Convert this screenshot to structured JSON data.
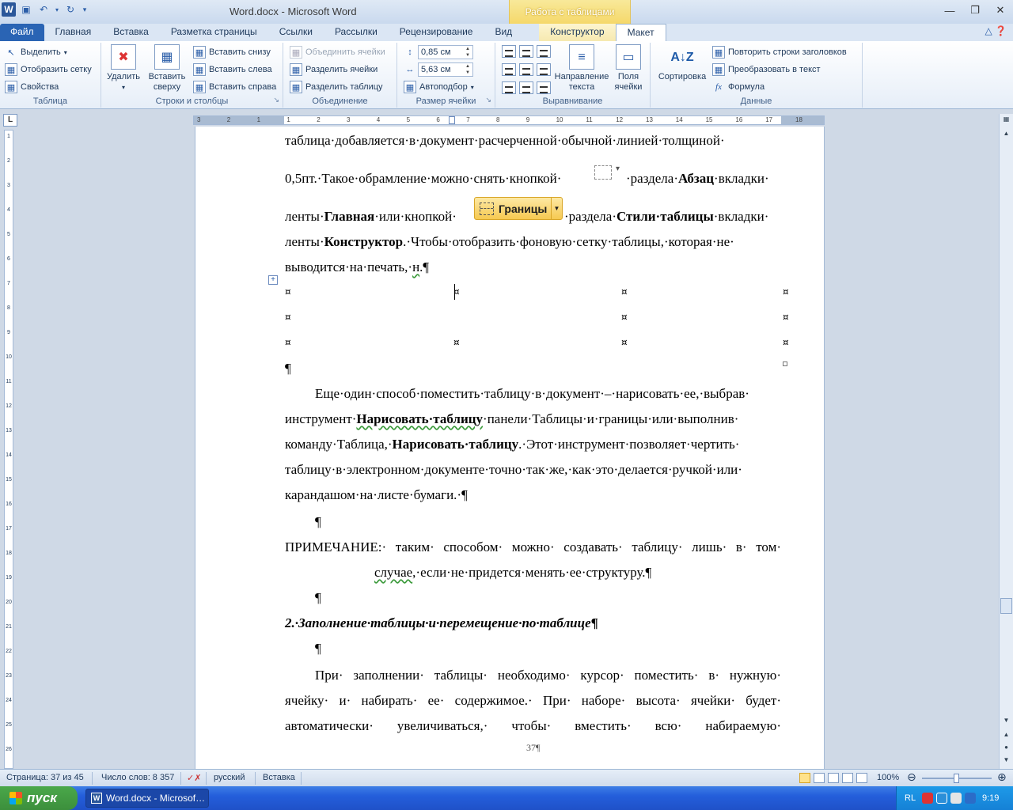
{
  "window": {
    "title": "Word.docx  -  Microsoft Word",
    "context_group": "Работа с таблицами"
  },
  "icons": {
    "word_logo": "W",
    "save": "save-icon",
    "undo": "undo-icon",
    "redo": "redo-icon"
  },
  "tabs": [
    {
      "label": "Файл"
    },
    {
      "label": "Главная"
    },
    {
      "label": "Вставка"
    },
    {
      "label": "Разметка страницы"
    },
    {
      "label": "Ссылки"
    },
    {
      "label": "Рассылки"
    },
    {
      "label": "Рецензирование"
    },
    {
      "label": "Вид"
    },
    {
      "label": "Конструктор"
    },
    {
      "label": "Макет"
    }
  ],
  "ribbon": {
    "table": {
      "label": "Таблица",
      "select": "Выделить",
      "show_grid": "Отобразить сетку",
      "properties": "Свойства"
    },
    "rows_cols": {
      "label": "Строки и столбцы",
      "delete": "Удалить",
      "insert_above_1": "Вставить",
      "insert_above_2": "сверху",
      "insert_below": "Вставить снизу",
      "insert_left": "Вставить слева",
      "insert_right": "Вставить справа"
    },
    "merge": {
      "label": "Объединение",
      "merge_cells": "Объединить ячейки",
      "split_cells": "Разделить ячейки",
      "split_table": "Разделить таблицу"
    },
    "cell_size": {
      "label": "Размер ячейки",
      "height": "0,85 см",
      "width": "5,63 см",
      "autofit": "Автоподбор"
    },
    "alignment": {
      "label": "Выравнивание",
      "direction_1": "Направление",
      "direction_2": "текста",
      "margins_1": "Поля",
      "margins_2": "ячейки"
    },
    "data": {
      "label": "Данные",
      "sort": "Сортировка",
      "repeat_header": "Повторить строки заголовков",
      "convert": "Преобразовать в текст",
      "formula": "Формула"
    }
  },
  "document": {
    "l1": "таблица·добавляется·в·документ·расчерченной·обычной·линией·толщиной·",
    "l2a": "0,5пт.·Такое·обрамление·можно·снять·кнопкой·",
    "l2b": "·раздела·",
    "l2c": "Абзац",
    "l2d": "·вкладки·",
    "l3a": "ленты·",
    "l3b": "Главная",
    "l3c": "·или·кнопкой·",
    "l3d": "·раздела·",
    "l3e": "Стили·таблицы",
    "l3f": "·вкладки·",
    "l4a": "ленты·",
    "l4b": "Конструктор",
    "l4c": ".·Чтобы·отобразить·фоновую·сетку·таблицы,·которая·не·",
    "l5a": "выводится·на·печать,·",
    "l5b": "н",
    "l5c": ".¶",
    "borders_button": "Границы",
    "cell_mark": "¤",
    "pilcrow": "¶",
    "p2_l1": "Еще·один·способ·поместить·таблицу·в·документ·–·нарисовать·ее,·выбрав·",
    "p2_l2a": "инструмент·",
    "p2_l2b": "Нарисовать·таблицу",
    "p2_l2c": "·панели·Таблицы·и·границы·или·выполнив·",
    "p2_l3a": "команду·Таблица,·",
    "p2_l3b": "Нарисовать·таблицу",
    "p2_l3c": ".·Этот·инструмент·позволяет·чертить·",
    "p2_l4": "таблицу·в·электронном·документе·точно·так·же,·как·это·делается·ручкой·или·",
    "p2_l5": "карандашом·на·листе·бумаги.·¶",
    "note_l1": "ПРИМЕЧАНИЕ:·  таким·  способом·  можно·  создавать·  таблицу·  лишь·  в·  том·",
    "note_l2a": "случае",
    "note_l2b": ",·если·не·придется·менять·ее·структуру.¶",
    "heading": "2.·Заполнение·таблицы·и·перемещение·по·таблице",
    "p3_l1": "При·  заполнении·  таблицы·  необходимо·  курсор·  поместить·  в·  нужную·",
    "p3_l2": "ячейку·  и·  набирать·  ее·  содержимое.·  При·  наборе·  высота·  ячейки·  будет·",
    "p3_l3": "автоматически·      увеличиваться,·      чтобы·      вместить·      всю·      набираемую·",
    "page_number": "37¶"
  },
  "ruler_numbers": [
    "3",
    "2",
    "1",
    "1",
    "2",
    "3",
    "4",
    "5",
    "6",
    "7",
    "8",
    "9",
    "10",
    "11",
    "12",
    "13",
    "14",
    "15",
    "16",
    "17",
    "18"
  ],
  "vruler_numbers": [
    "1",
    "2",
    "3",
    "4",
    "5",
    "6",
    "7",
    "8",
    "9",
    "10",
    "11",
    "12",
    "13",
    "14",
    "15",
    "16",
    "17",
    "18",
    "19",
    "20",
    "21",
    "22",
    "23",
    "24",
    "25",
    "26"
  ],
  "status": {
    "page": "Страница: 37 из 45",
    "words": "Число слов: 8 357",
    "language": "русский",
    "mode": "Вставка",
    "zoom": "100%"
  },
  "taskbar": {
    "start": "пуск",
    "task_word": "Word.docx - Microsof…",
    "lang": "RL",
    "time": "9:19"
  }
}
